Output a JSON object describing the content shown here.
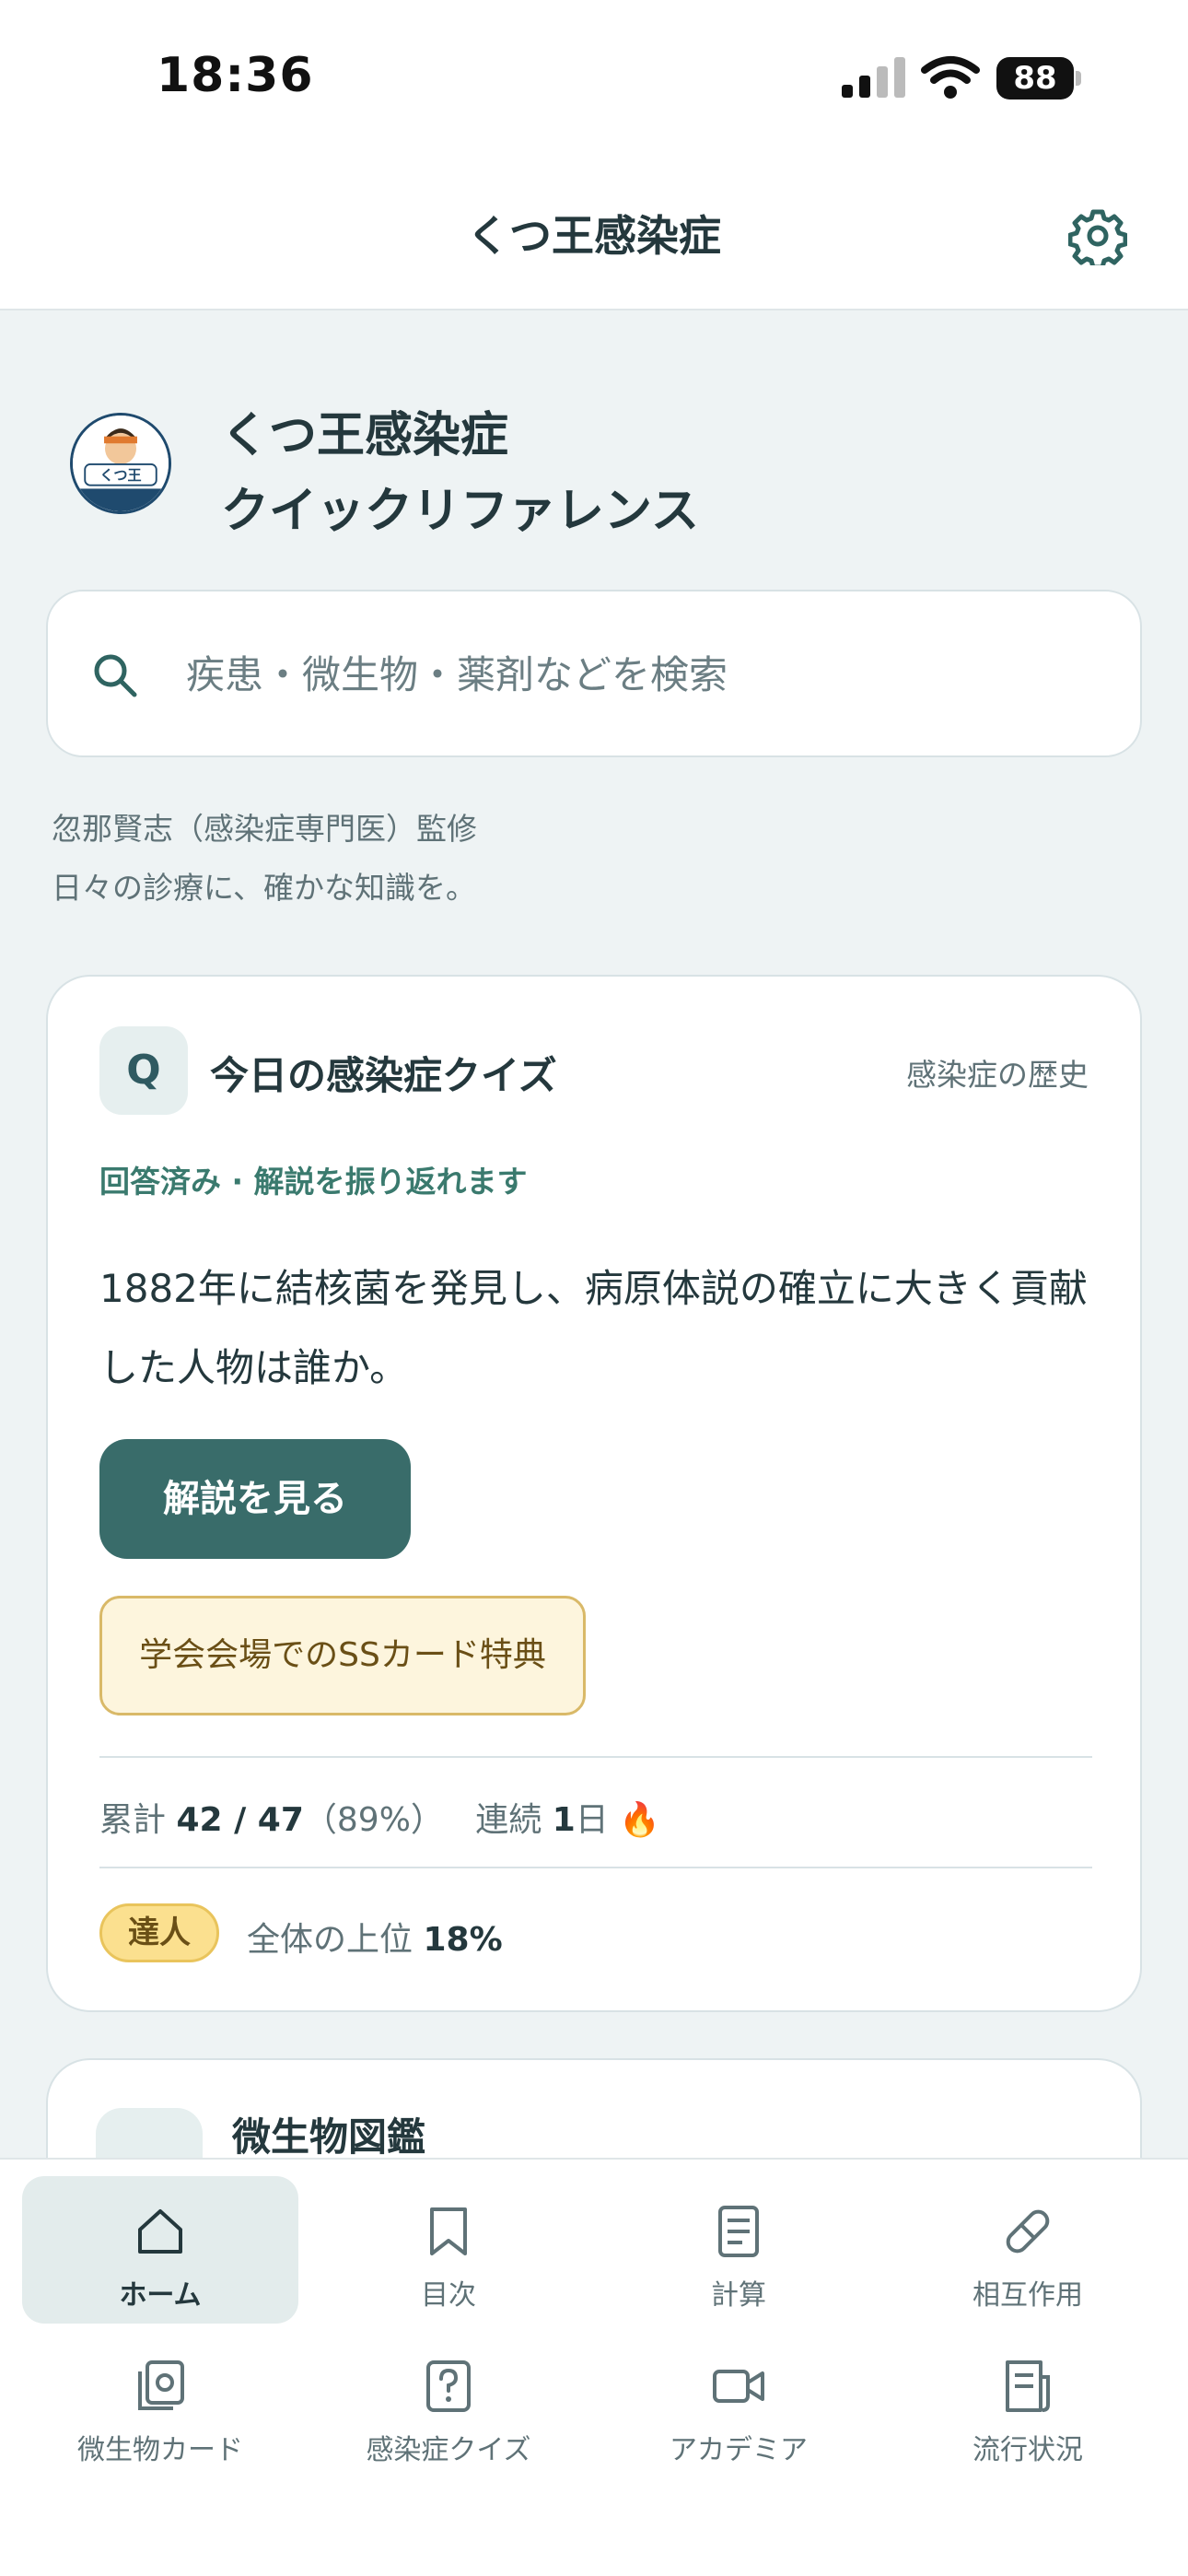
{
  "status_bar": {
    "time": "18:36",
    "battery": "88"
  },
  "header": {
    "title": "くつ王感染症"
  },
  "brand": {
    "line1": "くつ王感染症",
    "line2": "クイックリファレンス",
    "logo_text": "くつ王"
  },
  "search": {
    "placeholder": "疾患・微生物・薬剤などを検索"
  },
  "supervision": {
    "line1": "忽那賢志（感染症専門医）監修",
    "line2": "日々の診療に、確かな知識を。"
  },
  "quiz_card": {
    "badge": "Q",
    "title": "今日の感染症クイズ",
    "category": "感染症の歴史",
    "status": "回答済み · 解説を振り返れます",
    "question": "1882年に結核菌を発見し、病原体説の確立に大きく貢献した人物は誰か。",
    "button_label": "解説を見る",
    "perk_label": "学会会場でのSSカード特典",
    "stats": {
      "total_label": "累計",
      "total_value": "42 / 47",
      "total_pct": "（89%）",
      "streak_label": "連続",
      "streak_value": "1",
      "streak_unit": "日",
      "streak_emoji": "🔥"
    },
    "rank": {
      "badge": "達人",
      "label": "全体の上位",
      "value": "18%"
    }
  },
  "next_card": {
    "title": "微生物図鑑"
  },
  "tabbar": {
    "items": [
      {
        "label": "ホーム",
        "icon": "home-icon",
        "active": true
      },
      {
        "label": "目次",
        "icon": "bookmark-icon"
      },
      {
        "label": "計算",
        "icon": "document-icon"
      },
      {
        "label": "相互作用",
        "icon": "pill-icon"
      },
      {
        "label": "微生物カード",
        "icon": "card-stack-icon"
      },
      {
        "label": "感染症クイズ",
        "icon": "question-icon"
      },
      {
        "label": "アカデミア",
        "icon": "video-icon"
      },
      {
        "label": "流行状況",
        "icon": "report-icon"
      }
    ]
  },
  "colors": {
    "accent": "#396c6a",
    "background": "#eef3f4",
    "gold": "#fbe08f"
  }
}
